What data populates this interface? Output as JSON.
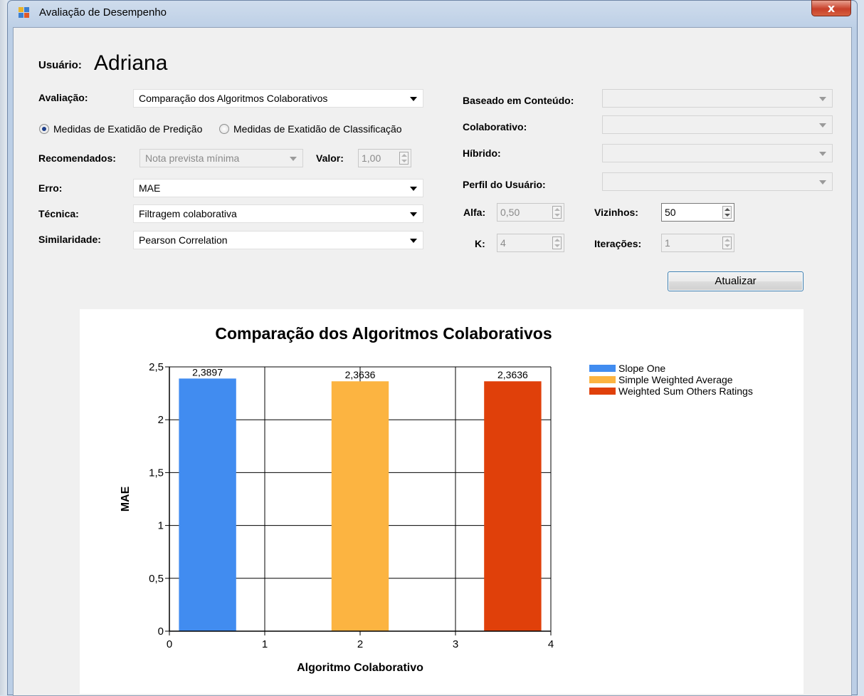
{
  "window": {
    "title": "Avaliação de Desempenho",
    "close_label": "x"
  },
  "user": {
    "label": "Usuário:",
    "name": "Adriana"
  },
  "form": {
    "avaliacao_label": "Avaliação:",
    "avaliacao_value": "Comparação dos Algoritmos Colaborativos",
    "radio_predicao": "Medidas de Exatidão de Predição",
    "radio_classificacao": "Medidas de Exatidão de Classificação",
    "radio_selected": "predicao",
    "recomendados_label": "Recomendados:",
    "recomendados_value": "Nota prevista mínima",
    "valor_label": "Valor:",
    "valor_value": "1,00",
    "erro_label": "Erro:",
    "erro_value": "MAE",
    "tecnica_label": "Técnica:",
    "tecnica_value": "Filtragem colaborativa",
    "similaridade_label": "Similaridade:",
    "similaridade_value": "Pearson Correlation",
    "conteudo_label": "Baseado em Conteúdo:",
    "conteudo_value": "",
    "colaborativo_label": "Colaborativo:",
    "colaborativo_value": "",
    "hibrido_label": "Híbrido:",
    "hibrido_value": "",
    "perfil_label": "Perfil do Usuário:",
    "perfil_value": "",
    "alfa_label": "Alfa:",
    "alfa_value": "0,50",
    "vizinhos_label": "Vizinhos:",
    "vizinhos_value": "50",
    "k_label": "K:",
    "k_value": "4",
    "iteracoes_label": "Iterações:",
    "iteracoes_value": "1",
    "atualizar_label": "Atualizar"
  },
  "chart_data": {
    "type": "bar",
    "title": "Comparação dos Algoritmos Colaborativos",
    "xlabel": "Algoritmo Colaborativo",
    "ylabel": "MAE",
    "xlim": [
      0,
      4
    ],
    "ylim": [
      0,
      2.5
    ],
    "xticks": [
      "0",
      "1",
      "2",
      "3",
      "4"
    ],
    "yticks": [
      "0",
      "0,5",
      "1",
      "1,5",
      "2",
      "2,5"
    ],
    "grid": true,
    "legend_position": "top-right",
    "series": [
      {
        "name": "Slope One",
        "x": 0.4,
        "value": 2.3897,
        "label": "2,3897",
        "color": "#418cf0"
      },
      {
        "name": "Simple Weighted Average",
        "x": 2.0,
        "value": 2.3636,
        "label": "2,3636",
        "color": "#fcb441"
      },
      {
        "name": "Weighted Sum Others Ratings",
        "x": 3.6,
        "value": 2.3636,
        "label": "2,3636",
        "color": "#e0400a"
      }
    ]
  }
}
